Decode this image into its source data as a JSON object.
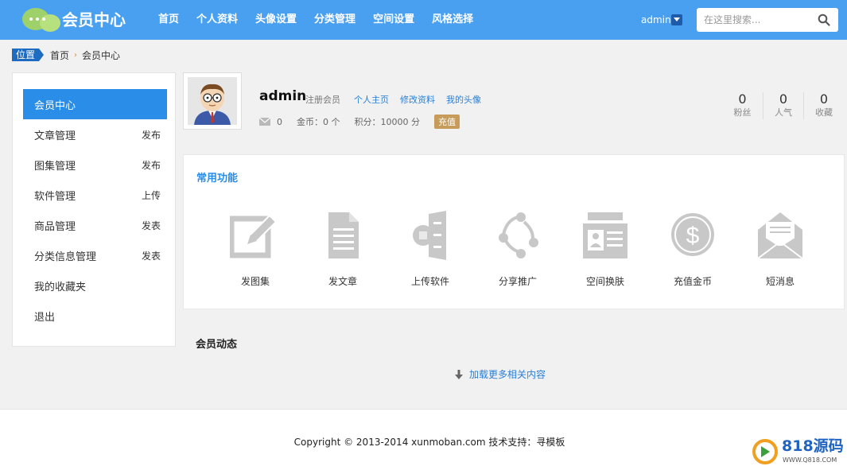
{
  "header": {
    "logo_text": "会员中心",
    "nav": [
      "首页",
      "个人资料",
      "头像设置",
      "分类管理",
      "空间设置",
      "风格选择"
    ],
    "user": "admin",
    "search_placeholder": "在这里搜索..."
  },
  "breadcrumb": {
    "tag": "位置",
    "items": [
      "首页",
      "会员中心"
    ],
    "separator": "›"
  },
  "sidebar": {
    "items": [
      {
        "label": "会员中心",
        "action": ""
      },
      {
        "label": "文章管理",
        "action": "发布"
      },
      {
        "label": "图集管理",
        "action": "发布"
      },
      {
        "label": "软件管理",
        "action": "上传"
      },
      {
        "label": "商品管理",
        "action": "发表"
      },
      {
        "label": "分类信息管理",
        "action": "发表"
      },
      {
        "label": "我的收藏夹",
        "action": ""
      },
      {
        "label": "退出",
        "action": ""
      }
    ]
  },
  "profile": {
    "username": "admin",
    "role": "注册会员",
    "links": [
      "个人主页",
      "修改资料",
      "我的头像"
    ],
    "messages": "0",
    "coins": "金币：0 个",
    "points": "积分：10000 分",
    "recharge": "充值",
    "counters": [
      {
        "num": "0",
        "label": "粉丝"
      },
      {
        "num": "0",
        "label": "人气"
      },
      {
        "num": "0",
        "label": "收藏"
      }
    ]
  },
  "functions": {
    "title": "常用功能",
    "items": [
      {
        "label": "发图集",
        "icon": "edit-icon"
      },
      {
        "label": "发文章",
        "icon": "document-icon"
      },
      {
        "label": "上传软件",
        "icon": "upload-software-icon"
      },
      {
        "label": "分享推广",
        "icon": "share-icon"
      },
      {
        "label": "空间换肤",
        "icon": "skin-icon"
      },
      {
        "label": "充值金币",
        "icon": "coin-icon"
      },
      {
        "label": "短消息",
        "icon": "envelope-icon"
      }
    ]
  },
  "activity": {
    "title": "会员动态",
    "load_more": "加载更多相关内容"
  },
  "footer": {
    "copyright": "Copyright © 2013-2014 xunmoban.com 技术支持：寻模板"
  },
  "watermark": {
    "text": "818源码",
    "url": "WWW.Q818.COM"
  },
  "colors": {
    "header_bg": "#4aa0f0",
    "accent": "#2a8ee8",
    "link": "#2a7fd4",
    "badge": "#c79c5a",
    "icon_gray": "#c8c8c8"
  }
}
